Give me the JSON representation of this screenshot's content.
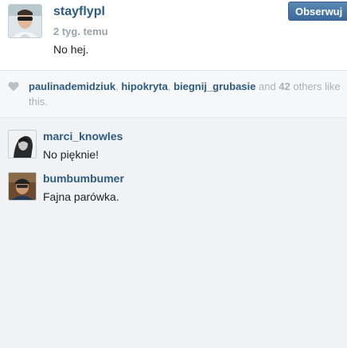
{
  "post": {
    "author": "stayflypl",
    "time_ago": "2 tyg. temu",
    "caption": "No hej.",
    "follow_label": "Obserwuj"
  },
  "likes": {
    "likers": [
      "paulinademidziuk",
      "hipokryta",
      "biegnij_grubasie"
    ],
    "separator": ", ",
    "and_word": " and ",
    "others_count": "42",
    "suffix": " others like this."
  },
  "comments": [
    {
      "user": "marci_knowles",
      "text": "No pięknie!"
    },
    {
      "user": "bumbumbumer",
      "text": "Fajna parówka."
    }
  ],
  "colors": {
    "link": "#2d5b82",
    "muted": "#a8b0b7",
    "follow_button": "#4a78a6"
  },
  "icons": {
    "like": "heart-icon"
  }
}
